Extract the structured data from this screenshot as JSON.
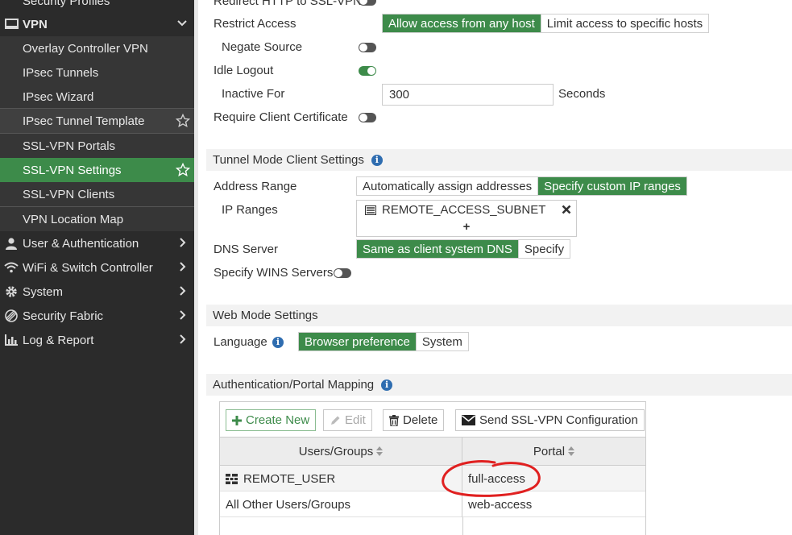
{
  "sidebar": {
    "top_cut": "Security Profiles",
    "vpn": "VPN",
    "items": [
      {
        "label": "Overlay Controller VPN"
      },
      {
        "label": "IPsec Tunnels"
      },
      {
        "label": "IPsec Wizard"
      },
      {
        "label": "IPsec Tunnel Template"
      },
      {
        "label": "SSL-VPN Portals"
      },
      {
        "label": "SSL-VPN Settings"
      },
      {
        "label": "SSL-VPN Clients"
      },
      {
        "label": "VPN Location Map"
      }
    ],
    "sections": [
      {
        "label": "User & Authentication",
        "icon": "user-icon"
      },
      {
        "label": "WiFi & Switch Controller",
        "icon": "wifi-icon"
      },
      {
        "label": "System",
        "icon": "gear-icon"
      },
      {
        "label": "Security Fabric",
        "icon": "fabric-icon"
      },
      {
        "label": "Log & Report",
        "icon": "chart-icon"
      }
    ]
  },
  "form": {
    "redirect_http": "Redirect HTTP to SSL-VPN",
    "restrict_access": "Restrict Access",
    "restrict_options": [
      "Allow access from any host",
      "Limit access to specific hosts"
    ],
    "negate_source": "Negate Source",
    "idle_logout": "Idle Logout",
    "inactive_for": "Inactive For",
    "inactive_value": "300",
    "seconds": "Seconds",
    "require_cert": "Require Client Certificate"
  },
  "tunnel": {
    "title": "Tunnel Mode Client Settings",
    "address_range": "Address Range",
    "address_options": [
      "Automatically assign addresses",
      "Specify custom IP ranges"
    ],
    "ip_ranges": "IP Ranges",
    "ip_range_entry": "REMOTE_ACCESS_SUBNET",
    "add_symbol": "+",
    "dns_server": "DNS Server",
    "dns_options": [
      "Same as client system DNS",
      "Specify"
    ],
    "wins": "Specify WINS Servers"
  },
  "web": {
    "title": "Web Mode Settings",
    "language": "Language",
    "language_options": [
      "Browser preference",
      "System"
    ]
  },
  "mapping": {
    "title": "Authentication/Portal Mapping",
    "buttons": {
      "create": "Create New",
      "edit": "Edit",
      "delete": "Delete",
      "send": "Send SSL-VPN Configuration"
    },
    "columns": [
      "Users/Groups",
      "Portal"
    ],
    "rows": [
      {
        "user": "REMOTE_USER",
        "portal": "full-access"
      },
      {
        "user": "All Other Users/Groups",
        "portal": "web-access"
      }
    ]
  },
  "colors": {
    "accent": "#3d8b4a",
    "sidebar_bg": "#2b2b2b",
    "annotation": "#e02020"
  }
}
